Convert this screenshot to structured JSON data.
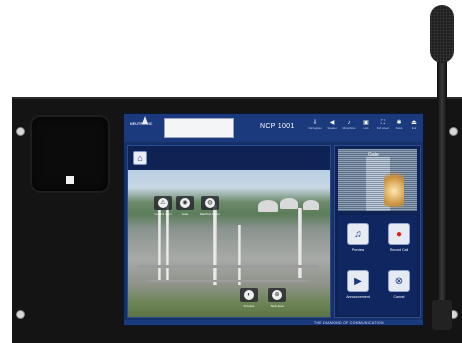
{
  "brand": {
    "logo_text": "NEUTRONIC"
  },
  "header": {
    "title": "NCP 1001",
    "icons": [
      {
        "icon": "incall-icon",
        "glyph": "⇩",
        "label": "Call register"
      },
      {
        "icon": "volume-icon",
        "glyph": "◀",
        "label": "Speaker"
      },
      {
        "icon": "mic-icon",
        "glyph": "♪",
        "label": "Microphone"
      },
      {
        "icon": "lock-icon",
        "glyph": "▣",
        "label": "Lock"
      },
      {
        "icon": "fullscreen-icon",
        "glyph": "⛶",
        "label": "Full screen"
      },
      {
        "icon": "settings-icon",
        "glyph": "✱",
        "label": "Setup"
      },
      {
        "icon": "exit-icon",
        "glyph": "⏏",
        "label": "Exit"
      }
    ]
  },
  "map": {
    "hotspots_top": [
      {
        "icon": "alarm-icon",
        "glyph": "⚠",
        "label": "Control room"
      },
      {
        "icon": "camera-icon",
        "glyph": "◉",
        "label": "Gate"
      },
      {
        "icon": "speaker-icon",
        "glyph": "◍",
        "label": "Machine Room"
      }
    ],
    "hotspots_bottom": [
      {
        "icon": "audio-icon",
        "glyph": "◐",
        "label": "Process"
      },
      {
        "icon": "zoom-icon",
        "glyph": "⊕",
        "label": "Tank area"
      }
    ]
  },
  "camera": {
    "label": "Gate"
  },
  "actions": [
    {
      "icon": "music-icon",
      "glyph": "♫",
      "label": "Preview",
      "color": "#1b3a7d"
    },
    {
      "icon": "record-icon",
      "glyph": "●",
      "label": "Record Call",
      "color": "#e02020"
    },
    {
      "icon": "play-icon",
      "glyph": "▶",
      "label": "Announcement",
      "color": "#1b3a7d"
    },
    {
      "icon": "cancel-icon",
      "glyph": "⊗",
      "label": "Cancel",
      "color": "#1b3a7d"
    }
  ],
  "footer": {
    "tagline": "THE DIAMOND OF COMMUNICATION"
  }
}
